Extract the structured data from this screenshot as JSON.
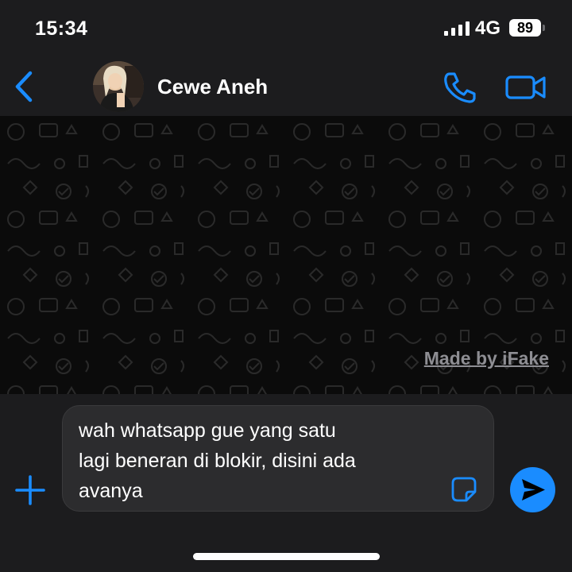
{
  "status_bar": {
    "time": "15:34",
    "network": "4G",
    "battery": "89",
    "icons": [
      "signal-bars-icon",
      "battery-icon"
    ]
  },
  "header": {
    "contact_name": "Cewe Aneh",
    "icons": [
      "back-chevron-icon",
      "phone-icon",
      "video-camera-icon"
    ]
  },
  "chat": {
    "watermark": "Made by iFake"
  },
  "composer": {
    "message": "wah whatsapp gue yang satu\nlagi beneran di blokir, disini ada\navanya",
    "icons": [
      "plus-icon",
      "sticker-icon",
      "send-icon"
    ]
  },
  "colors": {
    "accent": "#1a8cff",
    "header_bg": "#1c1c1e",
    "chat_bg": "#0b0b0b",
    "input_bg": "#2c2c2e"
  }
}
